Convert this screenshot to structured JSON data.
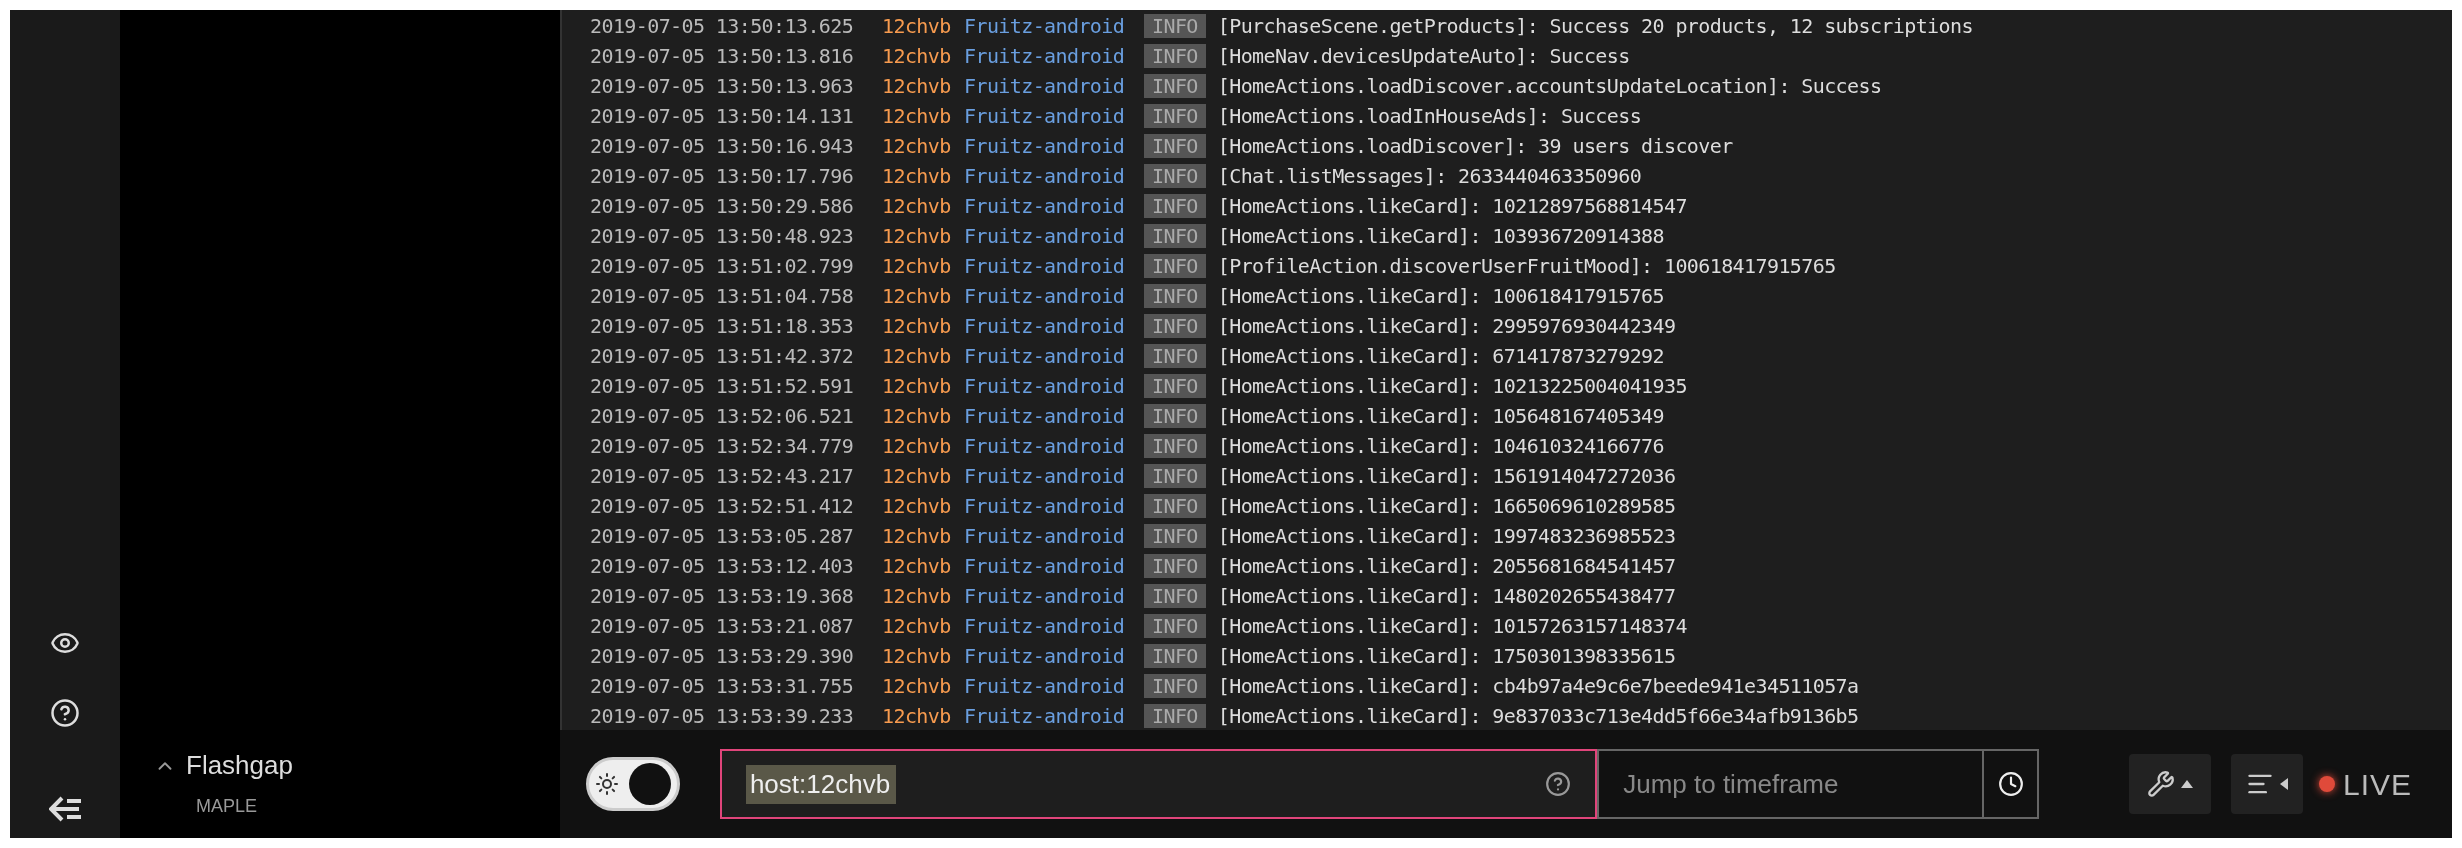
{
  "sidebar": {
    "app_name": "Flashgap",
    "app_expanded": true,
    "environment": "MAPLE"
  },
  "log": [
    {
      "time": "2019-07-05 13:50:13.625",
      "host": "12chvb",
      "app": "Fruitz-android",
      "level": "INFO",
      "message": "[PurchaseScene.getProducts]: Success 20 products, 12 subscriptions"
    },
    {
      "time": "2019-07-05 13:50:13.816",
      "host": "12chvb",
      "app": "Fruitz-android",
      "level": "INFO",
      "message": "[HomeNav.devicesUpdateAuto]: Success"
    },
    {
      "time": "2019-07-05 13:50:13.963",
      "host": "12chvb",
      "app": "Fruitz-android",
      "level": "INFO",
      "message": "[HomeActions.loadDiscover.accountsUpdateLocation]: Success"
    },
    {
      "time": "2019-07-05 13:50:14.131",
      "host": "12chvb",
      "app": "Fruitz-android",
      "level": "INFO",
      "message": "[HomeActions.loadInHouseAds]: Success"
    },
    {
      "time": "2019-07-05 13:50:16.943",
      "host": "12chvb",
      "app": "Fruitz-android",
      "level": "INFO",
      "message": "[HomeActions.loadDiscover]: 39 users discover"
    },
    {
      "time": "2019-07-05 13:50:17.796",
      "host": "12chvb",
      "app": "Fruitz-android",
      "level": "INFO",
      "message": "[Chat.listMessages]: 2633440463350960"
    },
    {
      "time": "2019-07-05 13:50:29.586",
      "host": "12chvb",
      "app": "Fruitz-android",
      "level": "INFO",
      "message": "[HomeActions.likeCard]: 10212897568814547"
    },
    {
      "time": "2019-07-05 13:50:48.923",
      "host": "12chvb",
      "app": "Fruitz-android",
      "level": "INFO",
      "message": "[HomeActions.likeCard]: 103936720914388"
    },
    {
      "time": "2019-07-05 13:51:02.799",
      "host": "12chvb",
      "app": "Fruitz-android",
      "level": "INFO",
      "message": "[ProfileAction.discoverUserFruitMood]: 100618417915765"
    },
    {
      "time": "2019-07-05 13:51:04.758",
      "host": "12chvb",
      "app": "Fruitz-android",
      "level": "INFO",
      "message": "[HomeActions.likeCard]: 100618417915765"
    },
    {
      "time": "2019-07-05 13:51:18.353",
      "host": "12chvb",
      "app": "Fruitz-android",
      "level": "INFO",
      "message": "[HomeActions.likeCard]: 2995976930442349"
    },
    {
      "time": "2019-07-05 13:51:42.372",
      "host": "12chvb",
      "app": "Fruitz-android",
      "level": "INFO",
      "message": "[HomeActions.likeCard]: 671417873279292"
    },
    {
      "time": "2019-07-05 13:51:52.591",
      "host": "12chvb",
      "app": "Fruitz-android",
      "level": "INFO",
      "message": "[HomeActions.likeCard]: 10213225004041935"
    },
    {
      "time": "2019-07-05 13:52:06.521",
      "host": "12chvb",
      "app": "Fruitz-android",
      "level": "INFO",
      "message": "[HomeActions.likeCard]: 105648167405349"
    },
    {
      "time": "2019-07-05 13:52:34.779",
      "host": "12chvb",
      "app": "Fruitz-android",
      "level": "INFO",
      "message": "[HomeActions.likeCard]: 104610324166776"
    },
    {
      "time": "2019-07-05 13:52:43.217",
      "host": "12chvb",
      "app": "Fruitz-android",
      "level": "INFO",
      "message": "[HomeActions.likeCard]: 1561914047272036"
    },
    {
      "time": "2019-07-05 13:52:51.412",
      "host": "12chvb",
      "app": "Fruitz-android",
      "level": "INFO",
      "message": "[HomeActions.likeCard]: 1665069610289585"
    },
    {
      "time": "2019-07-05 13:53:05.287",
      "host": "12chvb",
      "app": "Fruitz-android",
      "level": "INFO",
      "message": "[HomeActions.likeCard]: 1997483236985523"
    },
    {
      "time": "2019-07-05 13:53:12.403",
      "host": "12chvb",
      "app": "Fruitz-android",
      "level": "INFO",
      "message": "[HomeActions.likeCard]: 2055681684541457"
    },
    {
      "time": "2019-07-05 13:53:19.368",
      "host": "12chvb",
      "app": "Fruitz-android",
      "level": "INFO",
      "message": "[HomeActions.likeCard]: 1480202655438477"
    },
    {
      "time": "2019-07-05 13:53:21.087",
      "host": "12chvb",
      "app": "Fruitz-android",
      "level": "INFO",
      "message": "[HomeActions.likeCard]: 10157263157148374"
    },
    {
      "time": "2019-07-05 13:53:29.390",
      "host": "12chvb",
      "app": "Fruitz-android",
      "level": "INFO",
      "message": "[HomeActions.likeCard]: 1750301398335615"
    },
    {
      "time": "2019-07-05 13:53:31.755",
      "host": "12chvb",
      "app": "Fruitz-android",
      "level": "INFO",
      "message": "[HomeActions.likeCard]: cb4b97a4e9c6e7beede941e34511057a"
    },
    {
      "time": "2019-07-05 13:53:39.233",
      "host": "12chvb",
      "app": "Fruitz-android",
      "level": "INFO",
      "message": "[HomeActions.likeCard]: 9e837033c713e4dd5f66e34afb9136b5"
    }
  ],
  "toolbar": {
    "dark_mode": {
      "on": true
    },
    "query": {
      "value": "host:12chvb"
    },
    "timeframe": {
      "placeholder": "Jump to timeframe"
    },
    "live": {
      "label": "LIVE",
      "on": true
    }
  }
}
